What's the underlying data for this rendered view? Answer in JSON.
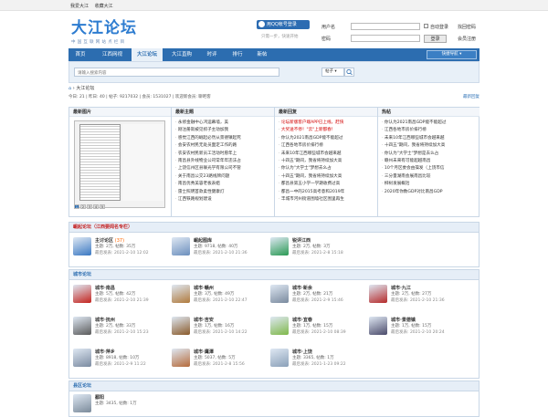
{
  "topbar": {
    "set_home": "我爱大江",
    "favorite": "收藏大江"
  },
  "logo": {
    "main": "大江论坛",
    "sub": "中国互联网站点栏目"
  },
  "qq_login": {
    "label": "用QQ帐号登录",
    "sub": "只需一步，快速开始"
  },
  "login": {
    "username_label": "用户名",
    "password_label": "密码",
    "auto_login": "自动登录",
    "find_password": "找回密码",
    "register": "会员注册",
    "login_button": "登录"
  },
  "nav": {
    "items": [
      "首页",
      "江西网视",
      "大江论坛",
      "大江直购",
      "时评",
      "排行",
      "新帖"
    ],
    "active_index": 2,
    "quick": "快捷导航"
  },
  "search": {
    "placeholder": "请输入搜索内容",
    "type": "帖子"
  },
  "breadcrumb": {
    "home": "⌂",
    "sep": "›",
    "current": "大江论坛"
  },
  "stats": {
    "text": "今日: 21 | 昨日: 40 | 帖子: 9217032 | 会员: 1531027 | 欢迎新会员: 聊吧客",
    "latest": "最新回复"
  },
  "grid": {
    "headers": [
      "最新图片",
      "最新主题",
      "最新回复",
      "热帖"
    ],
    "topics": [
      "永修金融中心鸿运幕墙，美",
      "刚注册就被见抓子主动加我",
      "感觉江西的崛起必然从景德镇起死",
      "会安农村民无处员面定工作的路",
      "农安农村民新员工活动时愿年上",
      "南昌县外线物业公司常年年违法占",
      "上饶信州区县联光学有限公司不管",
      "关于南昌公交23路线牌问题",
      "南昌优秀美容老板表姐",
      "雷士照明首款柔性健康灯",
      "江西铁路规划建设"
    ],
    "replies": [
      "论坛新版客户端APP已上线，赶快",
      "大奖送不停！\"云\"上新都春！",
      "你认为2021南昌GDP能不能超过",
      "江西各地市房价排行榜",
      "未来10年江西哪些城市会越来越",
      "十四五\"期间，我省将持续加大高",
      "你认为\"大学士\"梦想去么占",
      "十四五\"期间，我省将持续加大高",
      "都昌县第五小学一学期收费过高",
      "都昌一中的2015高考意和2019年",
      "丰城市河州街道围墙社区围里再生"
    ],
    "hot": [
      "你认为2021南昌GDP能不能超过",
      "江西各地市房价排行榜",
      "未来10年江西哪些城市会越来越",
      "十四五\"期间，我省将持续加大高",
      "你认为\"大学士\"梦想是去么占",
      "赣州未来有可能超越南昌",
      "10个月区委会由操发（上饶市信",
      "三分量湖南会展南昌比较",
      "柳树发展概括",
      "2020年你数GDP对比南昌GDP",
      ""
    ],
    "pager": [
      "1",
      "2",
      "3",
      "4",
      "5"
    ]
  },
  "section1": {
    "title": "崛起论坛（江西要闻名专栏）",
    "forums": [
      {
        "name": "主讨论区",
        "count": "(37)",
        "stat": "主题: 2万, 帖数: 35万",
        "last": "最后发表: 2021-2-10 12:02",
        "color": "#3a78c2"
      },
      {
        "name": "崛起图库",
        "count": "",
        "stat": "主题: 9718, 帖数: 40万",
        "last": "最后发表: 2021-2-10 21:36",
        "color": "#6b8fbd"
      },
      {
        "name": "锐评江西",
        "count": "",
        "stat": "主题: 2万, 帖数: 3万",
        "last": "最后发表: 2021-2-8 15:18",
        "color": "#2a9a54"
      }
    ]
  },
  "section2": {
    "title": "城市论坛",
    "forums": [
      {
        "name": "城市·南昌",
        "count": "",
        "stat": "主题: 5万, 帖数: 42万",
        "last": "最后发表: 2021-2-10 21:39",
        "color": "#c4231d"
      },
      {
        "name": "城市·赣州",
        "count": "",
        "stat": "主题: 3万, 帖数: 49万",
        "last": "最后发表: 2021-2-10 22:47",
        "color": "#b07a3c"
      },
      {
        "name": "城市·新余",
        "count": "",
        "stat": "主题: 2万, 帖数: 21万",
        "last": "最后发表: 2021-2-9 15:46",
        "color": "#7a8a9e"
      },
      {
        "name": "城市·九江",
        "count": "",
        "stat": "主题: 2万, 帖数: 27万",
        "last": "最后发表: 2021-2-10 21:36",
        "color": "#b52a2a"
      },
      {
        "name": "城市·抚州",
        "count": "",
        "stat": "主题: 2万, 帖数: 33万",
        "last": "最后发表: 2021-2-10 15:23",
        "color": "#5a5a5a"
      },
      {
        "name": "城市·吉安",
        "count": "",
        "stat": "主题: 1万, 帖数: 16万",
        "last": "最后发表: 2021-2-10 14:22",
        "color": "#8a5a2a"
      },
      {
        "name": "城市·宜春",
        "count": "",
        "stat": "主题: 1万, 帖数: 15万",
        "last": "最后发表: 2021-2-10 08:39",
        "color": "#7fb84a"
      },
      {
        "name": "城市·景德镇",
        "count": "",
        "stat": "主题: 1万, 帖数: 15万",
        "last": "最后发表: 2021-2-10 20:24",
        "color": "#4a4a6a"
      },
      {
        "name": "城市·萍乡",
        "count": "",
        "stat": "主题: 8918, 帖数: 10万",
        "last": "最后发表: 2021-2-9 11:22",
        "color": "#7a8aa0"
      },
      {
        "name": "城市·鹰潭",
        "count": "",
        "stat": "主题: 5037, 帖数: 5万",
        "last": "最后发表: 2021-2-8 15:56",
        "color": "#b56a3a"
      },
      {
        "name": "城市·上饶",
        "count": "",
        "stat": "主题: 3365, 帖数: 1万",
        "last": "最后发表: 2021-1-23 09:22",
        "color": "#8aa0b8"
      }
    ]
  },
  "section3": {
    "title": "县区论坛",
    "forums": [
      {
        "name": "鄱阳",
        "count": "",
        "stat": "主题: 3435, 帖数: 1万",
        "last": "",
        "color": "#7a8a9a"
      }
    ]
  }
}
